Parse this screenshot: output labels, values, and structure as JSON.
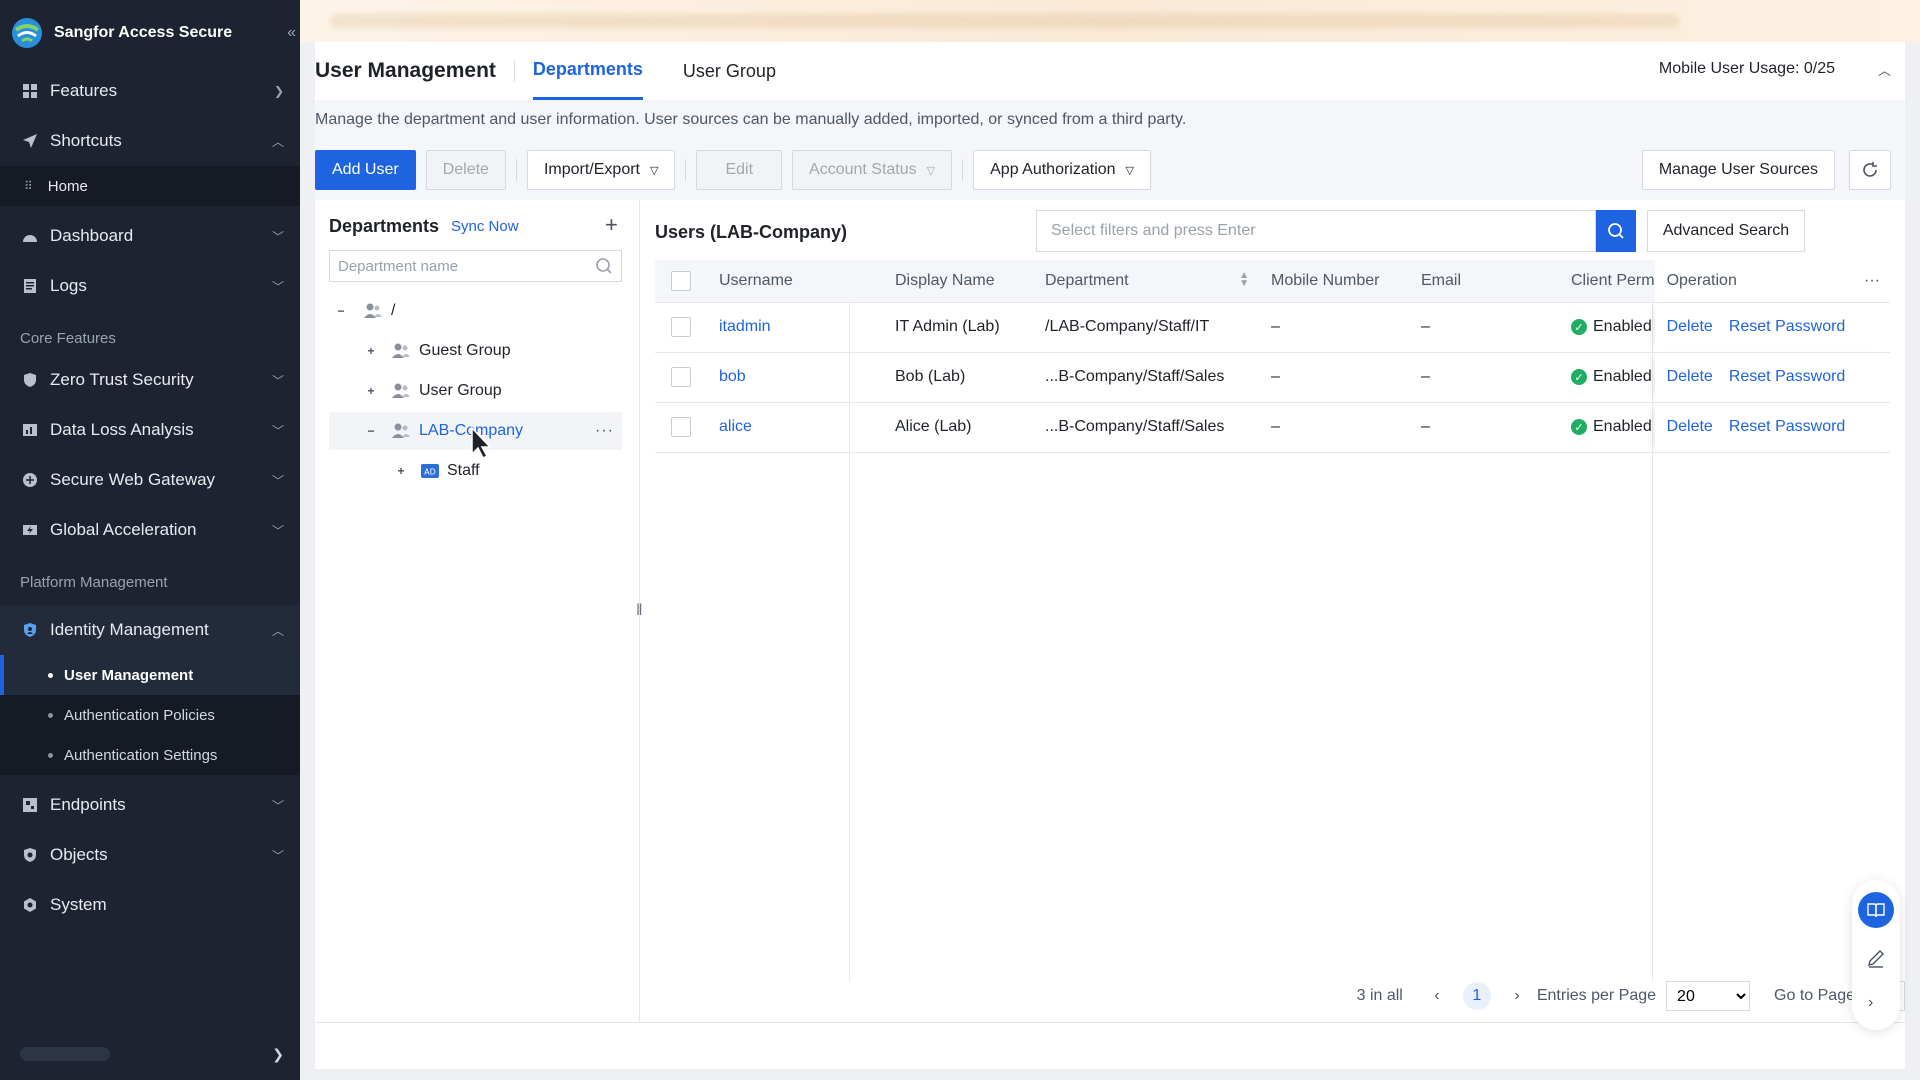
{
  "app": {
    "brand": "Sangfor Access Secure",
    "accent_color": "#1e64e0",
    "sidebar_bg": "#1d2331"
  },
  "sidebar": {
    "features": "Features",
    "shortcuts": "Shortcuts",
    "home": "Home",
    "dashboard": "Dashboard",
    "logs": "Logs",
    "core_features": "Core Features",
    "zero_trust": "Zero Trust Security",
    "data_loss": "Data Loss Analysis",
    "swg": "Secure Web Gateway",
    "global_accel": "Global Acceleration",
    "platform_mgmt": "Platform Management",
    "identity_mgmt": "Identity Management",
    "user_mgmt": "User Management",
    "auth_policies": "Authentication Policies",
    "auth_settings": "Authentication Settings",
    "endpoints": "Endpoints",
    "objects": "Objects",
    "system": "System"
  },
  "header": {
    "title": "User Management",
    "tab_departments": "Departments",
    "tab_user_group": "User Group",
    "usage": "Mobile User Usage: 0/25",
    "description": "Manage the department and user information. User sources can be manually added, imported, or synced from a third party."
  },
  "toolbar": {
    "add_user": "Add User",
    "delete": "Delete",
    "import_export": "Import/Export",
    "edit": "Edit",
    "account_status": "Account Status",
    "app_authorization": "App Authorization",
    "manage_sources": "Manage User Sources"
  },
  "departments": {
    "title": "Departments",
    "sync": "Sync Now",
    "search_placeholder": "Department name",
    "tree": {
      "root": "/",
      "guest": "Guest Group",
      "user_group": "User Group",
      "lab": "LAB-Company",
      "staff": "Staff"
    }
  },
  "users": {
    "title": "Users (LAB-Company)",
    "filter_placeholder": "Select filters and press Enter",
    "advanced_search": "Advanced Search",
    "columns": {
      "username": "Username",
      "display_name": "Display Name",
      "department": "Department",
      "mobile": "Mobile Number",
      "email": "Email",
      "client_perm": "Client Perm",
      "operation": "Operation"
    },
    "rows": [
      {
        "username": "itadmin",
        "display_name": "IT Admin (Lab)",
        "department": "/LAB-Company/Staff/IT",
        "mobile": "–",
        "email": "–",
        "status": "Enabled",
        "op_delete": "Delete",
        "op_reset": "Reset Password"
      },
      {
        "username": "bob",
        "display_name": "Bob (Lab)",
        "department": "...B-Company/Staff/Sales",
        "mobile": "–",
        "email": "–",
        "status": "Enabled",
        "op_delete": "Delete",
        "op_reset": "Reset Password"
      },
      {
        "username": "alice",
        "display_name": "Alice (Lab)",
        "department": "...B-Company/Staff/Sales",
        "mobile": "–",
        "email": "–",
        "status": "Enabled",
        "op_delete": "Delete",
        "op_reset": "Reset Password"
      }
    ]
  },
  "pager": {
    "total": "3 in all",
    "current": "1",
    "per_page_label": "Entries per Page",
    "per_page": "20",
    "goto": "Go to Page"
  }
}
